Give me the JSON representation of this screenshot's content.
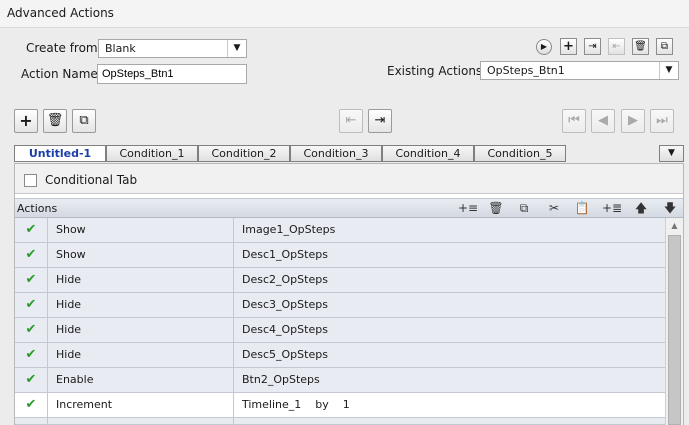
{
  "window": {
    "title": "Advanced Actions"
  },
  "create_from": {
    "label": "Create from:",
    "value": "Blank"
  },
  "action_name": {
    "label": "Action Name:",
    "value": "OpSteps_Btn1"
  },
  "existing_actions": {
    "label": "Existing Actions:",
    "value": "OpSteps_Btn1"
  },
  "tabs": [
    {
      "label": "Untitled-1",
      "active": true
    },
    {
      "label": "Condition_1",
      "active": false
    },
    {
      "label": "Condition_2",
      "active": false
    },
    {
      "label": "Condition_3",
      "active": false
    },
    {
      "label": "Condition_4",
      "active": false
    },
    {
      "label": "Condition_5",
      "active": false
    }
  ],
  "conditional_tab": {
    "label": "Conditional Tab",
    "checked": false
  },
  "actions_panel": {
    "header": "Actions"
  },
  "rows": [
    {
      "action": "Show",
      "target": "Image1_OpSteps",
      "valid": true
    },
    {
      "action": "Show",
      "target": "Desc1_OpSteps",
      "valid": true
    },
    {
      "action": "Hide",
      "target": "Desc2_OpSteps",
      "valid": true
    },
    {
      "action": "Hide",
      "target": "Desc3_OpSteps",
      "valid": true
    },
    {
      "action": "Hide",
      "target": "Desc4_OpSteps",
      "valid": true
    },
    {
      "action": "Hide",
      "target": "Desc5_OpSteps",
      "valid": true
    },
    {
      "action": "Enable",
      "target": "Btn2_OpSteps",
      "valid": true
    },
    {
      "action": "Increment",
      "target": "Timeline_1    by    1",
      "valid": true,
      "selected": true
    }
  ],
  "colors": {
    "valid_check": "#2a9a2a",
    "active_tab_text": "#1a3fa8",
    "row_bg": "#e8ebf1"
  }
}
